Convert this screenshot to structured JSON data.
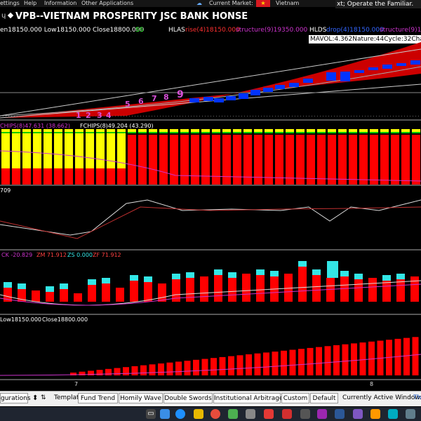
{
  "menubar": {
    "settings": "ettings",
    "help": "Help",
    "information": "Information",
    "other_apps": "Other Applications",
    "current_market": "Current Market:",
    "market_value": "Vietnam",
    "ticker": "xt; Operate the Familiar."
  },
  "title": "VPB--VIETNAM PROSPERITY JSC BANK  HONSE",
  "title_icon": "chevron-icon",
  "info": {
    "ohlc": "en18150.000 Low18150.000 Close18800.000",
    "ss": "SS",
    "hlas": "HLAS",
    "rise": "rise(4)18150.000",
    "structure1": "structure(9)19350.000",
    "hlds": "HLDS",
    "drop": "drop(4)18150.000",
    "structure2": "structure(9)14"
  },
  "tooltip": "MAVOL:4.362Nature:44Cycle:32Chan",
  "counts": [
    "1",
    "2",
    "3",
    "4",
    "5",
    "6",
    "7",
    "8",
    "9"
  ],
  "panel2": {
    "chips": "CHIPS(8)47.631 (38.662)",
    "fchips": "FCHIPS(8)49.204 (43.290)"
  },
  "panel3": {
    "label": "709"
  },
  "panel4": {
    "ck": "CK -20.829",
    "zm": "ZM 71.912",
    "zs": "ZS 0.000",
    "zf": "ZF 71.912"
  },
  "panel5": {
    "low": "Low18150.000",
    "close": "Close18800.000"
  },
  "xaxis": {
    "left": "7",
    "right": "8"
  },
  "bottombar": {
    "configurations": "gurations",
    "template": "Template",
    "tabs": [
      "Fund Trend",
      "Homily Wave",
      "Double Swords",
      "Institutional Arbitrage",
      "Custom",
      "Default"
    ],
    "active_window_label": "Currently Active Window:",
    "active_window_value": "Th"
  },
  "colors": {
    "up": "#ff0000",
    "down": "#0033ff",
    "cyan": "#33e6e6",
    "yellow": "#ffff00",
    "green": "#00cc00",
    "magenta": "#cc33cc"
  }
}
